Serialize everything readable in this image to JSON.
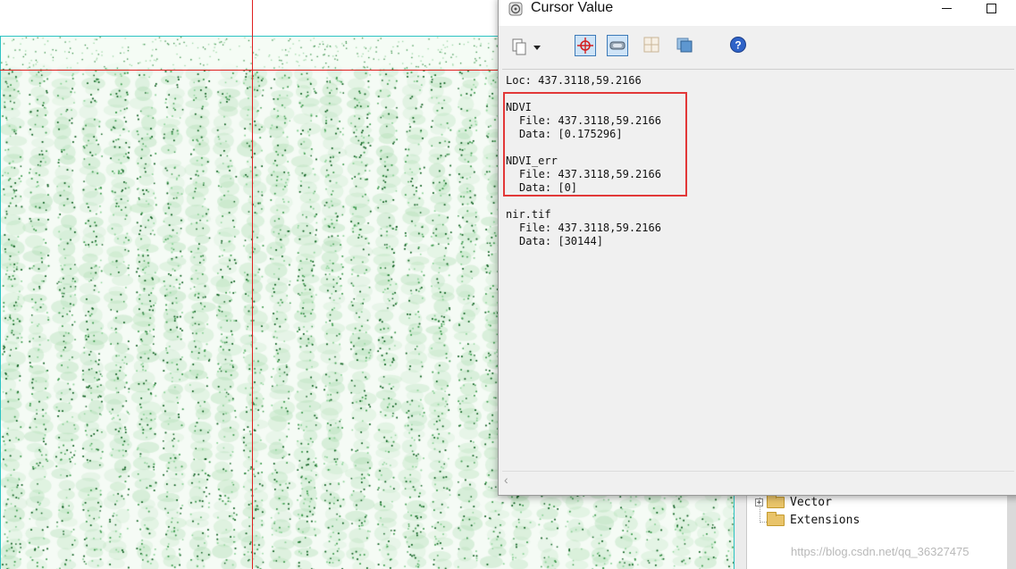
{
  "dialog": {
    "title": "Cursor Value",
    "toolbar": {
      "buttons": [
        {
          "name": "copy-menu",
          "icon": "document-copy-icon",
          "pressed": false
        },
        {
          "name": "crosshair-toggle",
          "icon": "crosshair-icon",
          "pressed": true
        },
        {
          "name": "link-views-toggle",
          "icon": "chain-link-icon",
          "pressed": true
        },
        {
          "name": "grid-toggle",
          "icon": "grid-icon",
          "pressed": false
        },
        {
          "name": "layers-toggle",
          "icon": "layers-icon",
          "pressed": false
        },
        {
          "name": "help",
          "icon": "help-icon",
          "pressed": false
        }
      ]
    },
    "location": {
      "label": "Loc:",
      "value": "437.3118,59.2166"
    },
    "layers": [
      {
        "name": "NDVI",
        "file_label": "File:",
        "file_value": "437.3118,59.2166",
        "data_label": "Data:",
        "data_value": "[0.175296]"
      },
      {
        "name": "NDVI_err",
        "file_label": "File:",
        "file_value": "437.3118,59.2166",
        "data_label": "Data:",
        "data_value": "[0]"
      },
      {
        "name": "nir.tif",
        "file_label": "File:",
        "file_value": "437.3118,59.2166",
        "data_label": "Data:",
        "data_value": "[30144]"
      }
    ]
  },
  "toolbox_tree": {
    "items": [
      {
        "label": "Vector",
        "expandable": true
      },
      {
        "label": "Extensions",
        "expandable": false
      }
    ]
  },
  "watermark": "https://blog.csdn.net/qq_36327475",
  "colors": {
    "highlight": "#e23838",
    "crosshair": "#e02020",
    "map_frame": "#2cc3c3",
    "vegetation_dark": "#0b5e1d",
    "vegetation_light": "#bfe6c2"
  }
}
